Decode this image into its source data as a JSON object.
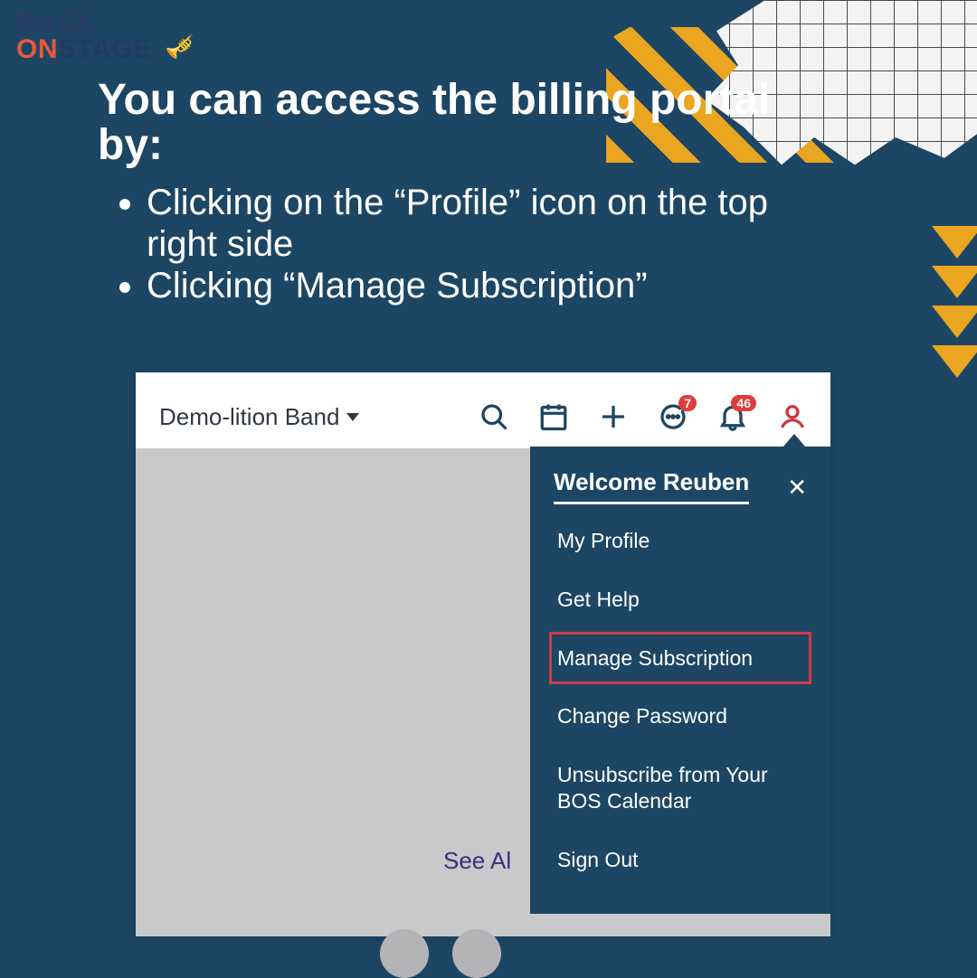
{
  "logo": {
    "line1": "BACK",
    "line2a": "ON",
    "line2b": "STAGE"
  },
  "instructions": {
    "heading": "You can access the billing portal by:",
    "bullets": [
      "Clicking on the “Profile” icon on the top right side",
      "Clicking “Manage Subscription”"
    ]
  },
  "topbar": {
    "band_label": "Demo-lition Band",
    "chat_badge": "7",
    "bell_badge": "46"
  },
  "content": {
    "see_all": "See Al"
  },
  "menu": {
    "welcome": "Welcome Reuben",
    "close": "✕",
    "items": [
      "My Profile",
      "Get Help",
      "Manage Subscription",
      "Change Password",
      "Unsubscribe from Your BOS Calendar",
      "Sign Out"
    ],
    "highlight_index": 2
  }
}
